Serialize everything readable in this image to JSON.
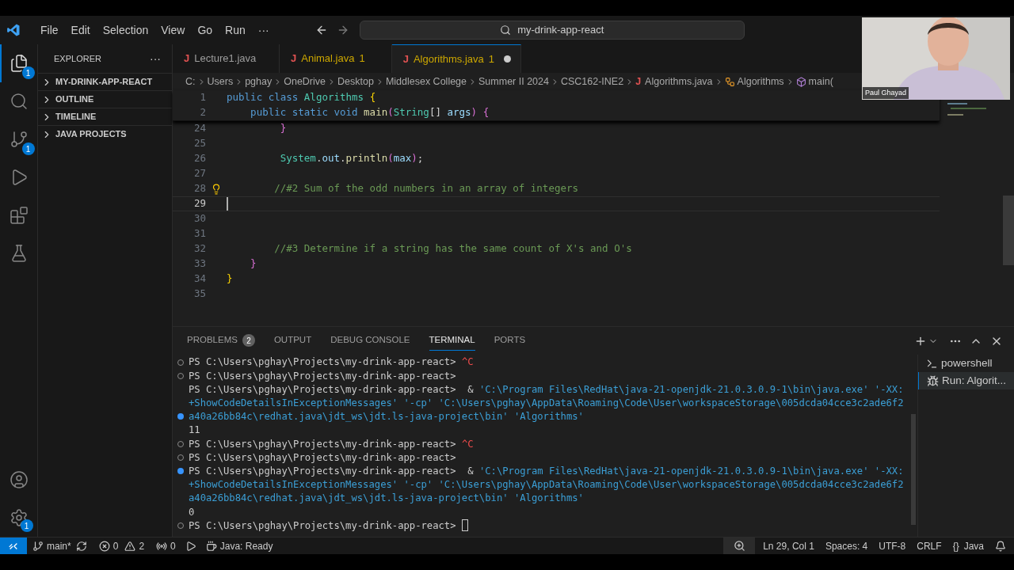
{
  "menu": [
    "File",
    "Edit",
    "Selection",
    "View",
    "Go",
    "Run",
    "···"
  ],
  "command_center": {
    "value": "my-drink-app-react"
  },
  "activity_bar": [
    {
      "kind": "files",
      "badge": "1",
      "selected": true
    },
    {
      "kind": "search",
      "selected": false
    },
    {
      "kind": "branch",
      "badge": "1",
      "selected": false
    },
    {
      "kind": "debug",
      "selected": false
    },
    {
      "kind": "extensions",
      "selected": false
    },
    {
      "kind": "flask",
      "selected": false
    }
  ],
  "activity_bottom": [
    {
      "kind": "account"
    },
    {
      "kind": "gear",
      "badge": "1"
    }
  ],
  "sidebar": {
    "title": "EXPLORER",
    "more": "···",
    "sections": [
      "MY-DRINK-APP-REACT",
      "OUTLINE",
      "TIMELINE",
      "JAVA PROJECTS"
    ]
  },
  "tabs": [
    {
      "glyph": "J",
      "label": "Lecture1.java",
      "selected": false,
      "dirty": false
    },
    {
      "glyph": "J",
      "label": "Animal.java",
      "problems": "1",
      "selected": false,
      "dirty": false
    },
    {
      "glyph": "J",
      "label": "Algorithms.java",
      "problems": "1",
      "selected": true,
      "dirty": true
    }
  ],
  "breadcrumb": [
    {
      "kind": "text",
      "label": "C:"
    },
    {
      "kind": "text",
      "label": "Users"
    },
    {
      "kind": "text",
      "label": "pghay"
    },
    {
      "kind": "text",
      "label": "OneDrive"
    },
    {
      "kind": "text",
      "label": "Desktop"
    },
    {
      "kind": "text",
      "label": "Middlesex College"
    },
    {
      "kind": "text",
      "label": "Summer II 2024"
    },
    {
      "kind": "text",
      "label": "CSC162-INE2"
    },
    {
      "kind": "file",
      "glyph": "J",
      "label": "Algorithms.java"
    },
    {
      "kind": "class",
      "label": "Algorithms"
    },
    {
      "kind": "method",
      "label": "main("
    }
  ],
  "sticky_lines": [
    {
      "number": "1",
      "tokens": [
        {
          "kind": "kw",
          "text": "public class "
        },
        {
          "kind": "type",
          "text": "Algorithms "
        },
        {
          "kind": "brace",
          "text": "{"
        }
      ]
    },
    {
      "number": "2",
      "tokens": [
        {
          "kind": "kw",
          "text": "    public static void "
        },
        {
          "kind": "fn",
          "text": "main"
        },
        {
          "kind": "paren",
          "text": "("
        },
        {
          "kind": "type",
          "text": "String"
        },
        {
          "kind": "punct",
          "text": "[] "
        },
        {
          "kind": "var",
          "text": "args"
        },
        {
          "kind": "paren",
          "text": ") {"
        }
      ]
    }
  ],
  "code_lines": [
    {
      "number": "24",
      "tokens": [
        {
          "kind": "paren",
          "text": "         }"
        }
      ]
    },
    {
      "number": "25"
    },
    {
      "number": "26",
      "tokens": [
        {
          "kind": "type",
          "text": "         System"
        },
        {
          "kind": "punct",
          "text": "."
        },
        {
          "kind": "var",
          "text": "out"
        },
        {
          "kind": "punct",
          "text": "."
        },
        {
          "kind": "fn",
          "text": "println"
        },
        {
          "kind": "paren",
          "text": "("
        },
        {
          "kind": "var",
          "text": "max"
        },
        {
          "kind": "paren",
          "text": ")"
        },
        {
          "kind": "punct",
          "text": ";"
        }
      ]
    },
    {
      "number": "27"
    },
    {
      "number": "28",
      "lightbulb": true,
      "tokens": [
        {
          "kind": "comment",
          "text": "        //#2 Sum of the odd numbers in an array of integers"
        }
      ]
    },
    {
      "number": "29",
      "current": true
    },
    {
      "number": "30"
    },
    {
      "number": "31"
    },
    {
      "number": "32",
      "tokens": [
        {
          "kind": "comment",
          "text": "        //#3 Determine if a string has the same count of X's and O's"
        }
      ]
    },
    {
      "number": "33",
      "tokens": [
        {
          "kind": "paren",
          "text": "    }"
        }
      ]
    },
    {
      "number": "34",
      "tokens": [
        {
          "kind": "brace",
          "text": "}"
        }
      ]
    },
    {
      "number": "35"
    }
  ],
  "panel_tabs": [
    {
      "label": "PROBLEMS",
      "badge": "2",
      "selected": false
    },
    {
      "label": "OUTPUT",
      "selected": false
    },
    {
      "label": "DEBUG CONSOLE",
      "selected": false
    },
    {
      "label": "TERMINAL",
      "selected": true
    },
    {
      "label": "PORTS",
      "selected": false
    }
  ],
  "terminal_lines": [
    {
      "kind": "done",
      "segments": [
        {
          "kind": "plain",
          "text": "PS C:\\Users\\pghay\\Projects\\my-drink-app-react> "
        },
        {
          "kind": "ctrl",
          "text": "^C"
        }
      ]
    },
    {
      "kind": "done",
      "segments": [
        {
          "kind": "plain",
          "text": "PS C:\\Users\\pghay\\Projects\\my-drink-app-react>"
        }
      ]
    },
    {
      "kind": "plain",
      "segments": [
        {
          "kind": "plain",
          "text": "PS C:\\Users\\pghay\\Projects\\my-drink-app-react>  & "
        },
        {
          "kind": "string",
          "text": "'C:\\Program Files\\RedHat\\java-21-openjdk-21.0.3.0.9-1\\bin\\java.exe' '-XX:"
        }
      ]
    },
    {
      "kind": "plain",
      "segments": [
        {
          "kind": "string",
          "text": "+ShowCodeDetailsInExceptionMessages' '-cp' 'C:\\Users\\pghay\\AppData\\Roaming\\Code\\User\\workspaceStorage\\005dcda04cce3c2ade6f2"
        }
      ]
    },
    {
      "kind": "active",
      "segments": [
        {
          "kind": "string",
          "text": "a40a26bb84c\\redhat.java\\jdt_ws\\jdt.ls-java-project\\bin' 'Algorithms'"
        }
      ]
    },
    {
      "kind": "plain",
      "segments": [
        {
          "kind": "plain",
          "text": "11"
        }
      ]
    },
    {
      "kind": "done",
      "segments": [
        {
          "kind": "plain",
          "text": "PS C:\\Users\\pghay\\Projects\\my-drink-app-react> "
        },
        {
          "kind": "ctrl",
          "text": "^C"
        }
      ]
    },
    {
      "kind": "done",
      "segments": [
        {
          "kind": "plain",
          "text": "PS C:\\Users\\pghay\\Projects\\my-drink-app-react>"
        }
      ]
    },
    {
      "kind": "active",
      "segments": [
        {
          "kind": "plain",
          "text": "PS C:\\Users\\pghay\\Projects\\my-drink-app-react>  & "
        },
        {
          "kind": "string",
          "text": "'C:\\Program Files\\RedHat\\java-21-openjdk-21.0.3.0.9-1\\bin\\java.exe' '-XX:"
        }
      ]
    },
    {
      "kind": "plain",
      "segments": [
        {
          "kind": "string",
          "text": "+ShowCodeDetailsInExceptionMessages' '-cp' 'C:\\Users\\pghay\\AppData\\Roaming\\Code\\User\\workspaceStorage\\005dcda04cce3c2ade6f2"
        }
      ]
    },
    {
      "kind": "plain",
      "segments": [
        {
          "kind": "string",
          "text": "a40a26bb84c\\redhat.java\\jdt_ws\\jdt.ls-java-project\\bin' 'Algorithms'"
        }
      ]
    },
    {
      "kind": "plain",
      "segments": [
        {
          "kind": "plain",
          "text": "0"
        }
      ]
    },
    {
      "kind": "done",
      "cursor": true,
      "segments": [
        {
          "kind": "plain",
          "text": "PS C:\\Users\\pghay\\Projects\\my-drink-app-react> "
        }
      ]
    }
  ],
  "terminals": [
    {
      "kind": "shell",
      "label": "powershell",
      "selected": false
    },
    {
      "kind": "debug",
      "label": "Run: Algorit...",
      "selected": true
    }
  ],
  "status_bar": {
    "branch": "main*",
    "errors": "0",
    "warnings": "2",
    "ports": "0",
    "java": "Java: Ready",
    "position": "Ln 29, Col 1",
    "spaces": "Spaces: 4",
    "encoding": "UTF-8",
    "eol": "CRLF",
    "braces": "{}",
    "language": "Java"
  },
  "webcam": {
    "kind": "picture",
    "name": "Paul Ghayad"
  }
}
